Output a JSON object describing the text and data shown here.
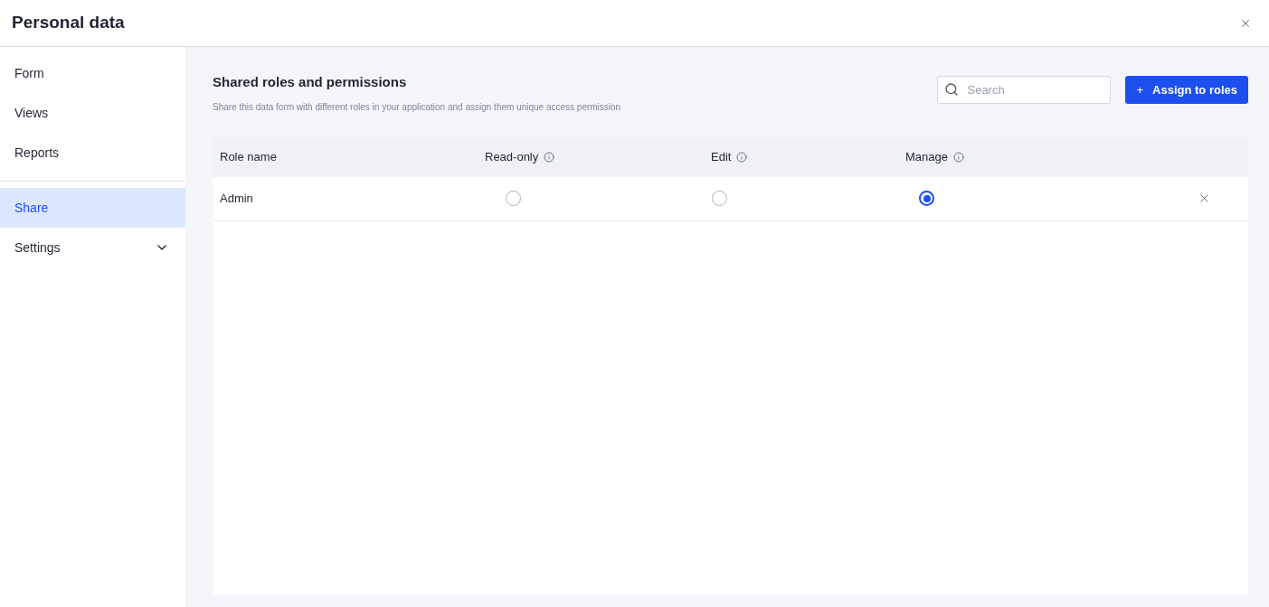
{
  "window": {
    "title": "Personal data"
  },
  "sidebar": {
    "items": [
      {
        "label": "Form",
        "selected": false,
        "kind": "link"
      },
      {
        "label": "Views",
        "selected": false,
        "kind": "link"
      },
      {
        "label": "Reports",
        "selected": false,
        "kind": "link"
      },
      {
        "label": "Share",
        "selected": true,
        "kind": "link"
      },
      {
        "label": "Settings",
        "selected": false,
        "kind": "group"
      }
    ]
  },
  "section": {
    "title": "Shared roles and permissions",
    "description": "Share this data form with different roles in your application and assign them unique access permission"
  },
  "search": {
    "placeholder": "Search"
  },
  "assign_button": {
    "icon": "+",
    "label": "Assign to roles"
  },
  "table": {
    "columns": [
      "Role name",
      "Read-only",
      "Edit",
      "Manage"
    ],
    "rows": [
      {
        "name": "Admin",
        "permissions": [
          {
            "selected": false
          },
          {
            "selected": false
          },
          {
            "selected": true
          }
        ]
      }
    ]
  }
}
